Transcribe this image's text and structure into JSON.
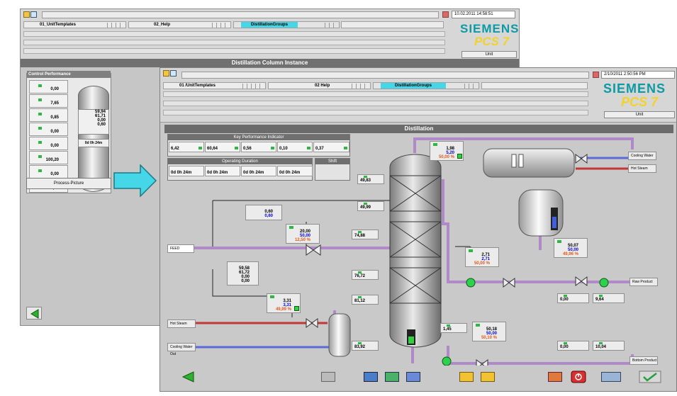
{
  "back_window": {
    "date": "10.02.2011 14:58:51",
    "areas": [
      "01_UnitTemplates",
      "02_Help",
      "DistillationGroups"
    ],
    "brand": "SIEMENS",
    "product": "PCS 7",
    "unit_label": "Unit",
    "title": "Distillation Column Instance",
    "panel_title": "Control Performance",
    "values": [
      "0,00",
      "7,65",
      "0,85",
      "0,00",
      "0,00",
      "100,20",
      "0,00",
      "0,00"
    ],
    "vessel_values": [
      "59,94",
      "61,71",
      "0,00",
      "0,60"
    ],
    "vessel_time": "0d 0h 24m",
    "process_button": "Process-Picture"
  },
  "front_window": {
    "date": "2/10/2011 2:50:56 PM",
    "areas": [
      "01 /UnitTemplates",
      "02 Help",
      "DistillationGroups"
    ],
    "brand": "SIEMENS",
    "product": "PCS 7",
    "unit_label": "Unit",
    "title": "Distillation",
    "kpi": {
      "header": "Key Performance Indicator",
      "values": [
        "6,42",
        "60,64",
        "0,56",
        "0,10",
        "0,37"
      ],
      "runtime_header": "Operating Duration",
      "runtime_values": [
        "0d 0h 24m",
        "0d 0h 24m",
        "0d 0h 24m",
        "0d 0h 24m"
      ],
      "shift": "Shift"
    },
    "tags": {
      "tc_top": {
        "pv": "1,98",
        "sp": "5,20",
        "op": "50,00 %"
      },
      "pic": {
        "pv": "20,00",
        "sp": "50,00",
        "op": "12,50 %"
      },
      "pic_comp": {
        "pv": "0,60",
        "sp": "0,60"
      },
      "ti_1": "49,83",
      "ti_2": "49,99",
      "ti_3": "74,88",
      "ti_4": "76,72",
      "ti_5": "81,12",
      "ti_6": "83,92",
      "fc_left": {
        "pv": "59,58",
        "sp": "61,72",
        "op1": "0,00",
        "op2": "0,00"
      },
      "fc_reflux": {
        "pv": "2,71",
        "sp": "2,71",
        "op": "50,00 %"
      },
      "lc_drum": {
        "pv": "50,07",
        "sp": "50,00",
        "op": "49,96 %"
      },
      "fc_steam": {
        "pv": "3,31",
        "sp": "3,31",
        "op": "49,99 %"
      },
      "lc_bottom": {
        "pv": "50,18",
        "sp": "50,00",
        "op": "50,10 %"
      },
      "bottom_flow": "1,45",
      "out_flow": "0,00",
      "out_flow2": "10,04",
      "dist_flow1": "0,00",
      "dist_flow2": "9,64"
    },
    "feed_label": "FEED",
    "streams": {
      "cooling_water_top": "Cooling Water",
      "hot_steam_top": "Hot Steam",
      "hot_steam": "Hot Steam",
      "cooling_water_out": "Cooling Water Out",
      "raw_product": "Raw Product",
      "bottom_product": "Bottom Product"
    }
  },
  "colors": {
    "accent_cyan": "#45d6e8",
    "status_green": "#2db843",
    "pipe_purple": "#b08ac8",
    "pipe_blue": "#5a6ad8",
    "pipe_red": "#c23838",
    "brand_teal": "#0c9aa3",
    "brand_yellow": "#f2d22b"
  }
}
